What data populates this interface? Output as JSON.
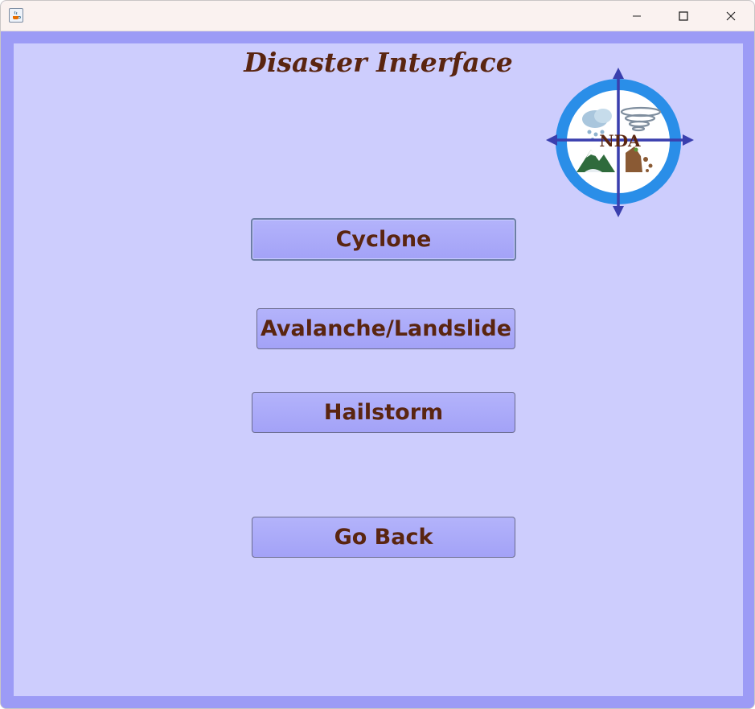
{
  "window": {
    "controls": [
      "minimize-icon",
      "maximize-icon",
      "close-icon"
    ]
  },
  "panel": {
    "title": "Disaster Interface",
    "logo_text": "NDA"
  },
  "buttons": {
    "cyclone": "Cyclone",
    "avalanche": "Avalanche/Landslide",
    "hailstorm": "Hailstorm",
    "go_back": "Go Back"
  },
  "colors": {
    "panel_bg": "#cdcdfd",
    "frame_bg": "#9c9bf6",
    "button_bg": "#a6a5f8",
    "text": "#5a2510",
    "logo_ring": "#2a8ee8",
    "logo_cross": "#3a3fae"
  }
}
